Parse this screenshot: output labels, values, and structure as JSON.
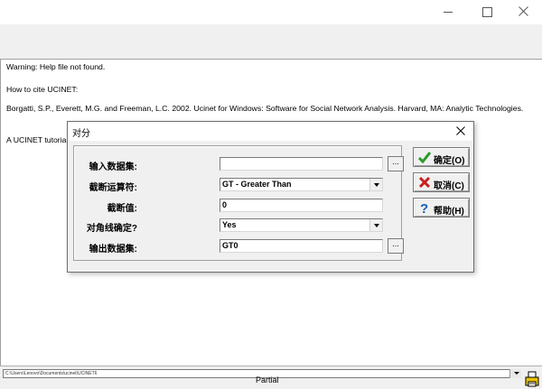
{
  "window": {
    "controls": {
      "minimize": "minimize-icon",
      "maximize": "maximize-icon",
      "close": "close-icon"
    }
  },
  "log": {
    "lines": [
      "Warning: Help file not found.",
      "How to cite UCINET:",
      "Borgatti, S.P., Everett, M.G. and Freeman, L.C. 2002. Ucinet for Windows: Software for Social Network Analysis. Harvard, MA: Analytic Technologies.",
      "A UCINET tutorial"
    ]
  },
  "statusbar": {
    "path": "C:\\Users\\Lenovo\\Documents\\ucinet\\UCINET6",
    "hidden_text": "Partial"
  },
  "dialog": {
    "title": "对分",
    "fields": {
      "input_dataset": {
        "label": "输入数据集:",
        "value": ""
      },
      "operator": {
        "label": "截断运算符:",
        "value": "GT - Greater Than"
      },
      "cutoff": {
        "label": "截断值:",
        "value": "0"
      },
      "diagonal": {
        "label": "对角线确定?",
        "value": "Yes"
      },
      "output_dataset": {
        "label": "输出数据集:",
        "value": "GT0"
      }
    },
    "browse_label": "...",
    "buttons": {
      "ok": "确定(O)",
      "cancel": "取消(C)",
      "help": "帮助(H)"
    }
  },
  "colors": {
    "ok_check": "#2a9a2a",
    "cancel_x": "#c81e1e",
    "help_q": "#1a5fb4"
  }
}
